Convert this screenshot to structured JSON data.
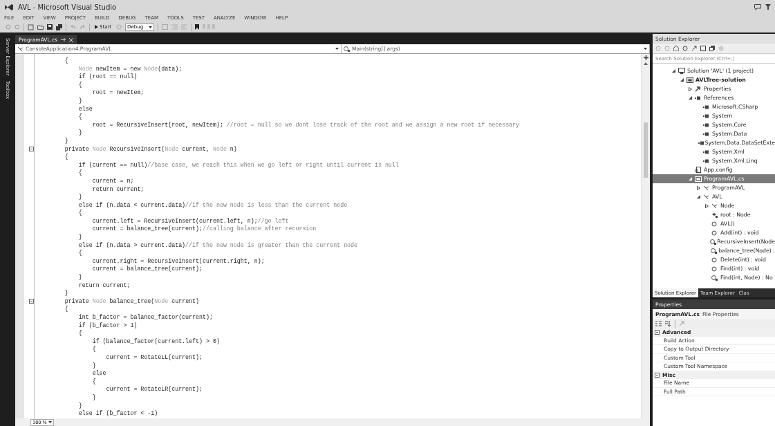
{
  "window": {
    "title": "AVL - Microsoft Visual Studio"
  },
  "menu": [
    "FILE",
    "EDIT",
    "VIEW",
    "PROJECT",
    "BUILD",
    "DEBUG",
    "TEAM",
    "TOOLS",
    "TEST",
    "ANALYZE",
    "WINDOW",
    "HELP"
  ],
  "toolbar": {
    "start": "Start",
    "configuration": "Debug"
  },
  "side_tabs": [
    "Server Explorer",
    "Toolbox"
  ],
  "editor": {
    "tabs": [
      {
        "label": "ProgramAVL.cs",
        "selected": true
      }
    ],
    "type_nav": "ConsoleApplication4.ProgramAVL",
    "member_nav": "Main(string[] args)",
    "zoom": "100 %",
    "lines": [
      {
        "fold": false,
        "tokens": [
          {
            "kind": "plain",
            "text": "        {"
          }
        ]
      },
      {
        "fold": false,
        "tokens": [
          {
            "kind": "type",
            "text": "            Node"
          },
          {
            "kind": "plain",
            "text": " newItem = new "
          },
          {
            "kind": "type",
            "text": "Node"
          },
          {
            "kind": "plain",
            "text": "(data);"
          }
        ]
      },
      {
        "fold": false,
        "tokens": [
          {
            "kind": "plain",
            "text": "            if (root == null)"
          }
        ]
      },
      {
        "fold": false,
        "tokens": [
          {
            "kind": "plain",
            "text": "            {"
          }
        ]
      },
      {
        "fold": false,
        "tokens": [
          {
            "kind": "plain",
            "text": "                root = newItem;"
          }
        ]
      },
      {
        "fold": false,
        "tokens": [
          {
            "kind": "plain",
            "text": "            }"
          }
        ]
      },
      {
        "fold": false,
        "tokens": [
          {
            "kind": "plain",
            "text": "            else"
          }
        ]
      },
      {
        "fold": false,
        "tokens": [
          {
            "kind": "plain",
            "text": "            {"
          }
        ]
      },
      {
        "fold": false,
        "tokens": [
          {
            "kind": "plain",
            "text": "                root = RecursiveInsert(root, newItem); "
          },
          {
            "kind": "comment",
            "text": "//root = null so we dont lose track of the root and we assign a new root if necessary"
          }
        ]
      },
      {
        "fold": false,
        "tokens": [
          {
            "kind": "plain",
            "text": "            }"
          }
        ]
      },
      {
        "fold": false,
        "tokens": [
          {
            "kind": "plain",
            "text": "        }"
          }
        ]
      },
      {
        "fold": true,
        "tokens": [
          {
            "kind": "plain",
            "text": "        private "
          },
          {
            "kind": "type",
            "text": "Node"
          },
          {
            "kind": "plain",
            "text": " RecursiveInsert("
          },
          {
            "kind": "type",
            "text": "Node"
          },
          {
            "kind": "plain",
            "text": " current, "
          },
          {
            "kind": "type",
            "text": "Node"
          },
          {
            "kind": "plain",
            "text": " n)"
          }
        ]
      },
      {
        "fold": false,
        "tokens": [
          {
            "kind": "plain",
            "text": "        {"
          }
        ]
      },
      {
        "fold": false,
        "tokens": [
          {
            "kind": "plain",
            "text": "            if (current == null)"
          },
          {
            "kind": "comment",
            "text": "//base case, we reach this when we go left or right until current is null"
          }
        ]
      },
      {
        "fold": false,
        "tokens": [
          {
            "kind": "plain",
            "text": "            {"
          }
        ]
      },
      {
        "fold": false,
        "tokens": [
          {
            "kind": "plain",
            "text": "                current = n;"
          }
        ]
      },
      {
        "fold": false,
        "tokens": [
          {
            "kind": "plain",
            "text": "                return current;"
          }
        ]
      },
      {
        "fold": false,
        "tokens": [
          {
            "kind": "plain",
            "text": "            }"
          }
        ]
      },
      {
        "fold": false,
        "tokens": [
          {
            "kind": "plain",
            "text": "            else if (n.data < current.data)"
          },
          {
            "kind": "comment",
            "text": "//if the new node is less than the current node"
          }
        ]
      },
      {
        "fold": false,
        "tokens": [
          {
            "kind": "plain",
            "text": "            {"
          }
        ]
      },
      {
        "fold": false,
        "tokens": [
          {
            "kind": "plain",
            "text": "                current.left = RecursiveInsert(current.left, n);"
          },
          {
            "kind": "comment",
            "text": "//go left"
          }
        ]
      },
      {
        "fold": false,
        "tokens": [
          {
            "kind": "plain",
            "text": "                current = balance_tree(current);"
          },
          {
            "kind": "comment",
            "text": "//calling balance after recursion"
          }
        ]
      },
      {
        "fold": false,
        "tokens": [
          {
            "kind": "plain",
            "text": "            }"
          }
        ]
      },
      {
        "fold": false,
        "tokens": [
          {
            "kind": "plain",
            "text": "            else if (n.data > current.data)"
          },
          {
            "kind": "comment",
            "text": "//if the new node is greater than the current node"
          }
        ]
      },
      {
        "fold": false,
        "tokens": [
          {
            "kind": "plain",
            "text": "            {"
          }
        ]
      },
      {
        "fold": false,
        "tokens": [
          {
            "kind": "plain",
            "text": "                current.right = RecursiveInsert(current.right, n);"
          }
        ]
      },
      {
        "fold": false,
        "tokens": [
          {
            "kind": "plain",
            "text": "                current = balance_tree(current);"
          }
        ]
      },
      {
        "fold": false,
        "tokens": [
          {
            "kind": "plain",
            "text": "            }"
          }
        ]
      },
      {
        "fold": false,
        "tokens": [
          {
            "kind": "plain",
            "text": "            return current;"
          }
        ]
      },
      {
        "fold": false,
        "tokens": [
          {
            "kind": "plain",
            "text": "        }"
          }
        ]
      },
      {
        "fold": true,
        "tokens": [
          {
            "kind": "plain",
            "text": "        private "
          },
          {
            "kind": "type",
            "text": "Node"
          },
          {
            "kind": "plain",
            "text": " balance_tree("
          },
          {
            "kind": "type",
            "text": "Node"
          },
          {
            "kind": "plain",
            "text": " current)"
          }
        ]
      },
      {
        "fold": false,
        "tokens": [
          {
            "kind": "plain",
            "text": "        {"
          }
        ]
      },
      {
        "fold": false,
        "tokens": [
          {
            "kind": "plain",
            "text": "            int b_factor = balance_factor(current);"
          }
        ]
      },
      {
        "fold": false,
        "tokens": [
          {
            "kind": "plain",
            "text": "            if (b_factor > 1)"
          }
        ]
      },
      {
        "fold": false,
        "tokens": [
          {
            "kind": "plain",
            "text": "            {"
          }
        ]
      },
      {
        "fold": false,
        "tokens": [
          {
            "kind": "plain",
            "text": "                if (balance_factor(current.left) > 0)"
          }
        ]
      },
      {
        "fold": false,
        "tokens": [
          {
            "kind": "plain",
            "text": "                {"
          }
        ]
      },
      {
        "fold": false,
        "tokens": [
          {
            "kind": "plain",
            "text": "                    current = RotateLL(current);"
          }
        ]
      },
      {
        "fold": false,
        "tokens": [
          {
            "kind": "plain",
            "text": "                }"
          }
        ]
      },
      {
        "fold": false,
        "tokens": [
          {
            "kind": "plain",
            "text": "                else"
          }
        ]
      },
      {
        "fold": false,
        "tokens": [
          {
            "kind": "plain",
            "text": "                {"
          }
        ]
      },
      {
        "fold": false,
        "tokens": [
          {
            "kind": "plain",
            "text": "                    current = RotateLR(current);"
          }
        ]
      },
      {
        "fold": false,
        "tokens": [
          {
            "kind": "plain",
            "text": "                }"
          }
        ]
      },
      {
        "fold": false,
        "tokens": [
          {
            "kind": "plain",
            "text": "            }"
          }
        ]
      },
      {
        "fold": false,
        "tokens": [
          {
            "kind": "plain",
            "text": "            else if (b_factor < -1)"
          }
        ]
      }
    ]
  },
  "solution_explorer": {
    "title": "Solution Explorer",
    "search": {
      "placeholder": "Search Solution Explorer (Ctrl+;)"
    },
    "tree": [
      {
        "label": "Solution 'AVL' (1 project)",
        "kind": "solution",
        "selected": false,
        "expanded": true,
        "children": [
          {
            "label": "AVLTree-solution",
            "kind": "project",
            "selected": false,
            "expanded": true,
            "children": [
              {
                "label": "Properties",
                "kind": "properties",
                "selected": false,
                "expanded": false
              },
              {
                "label": "References",
                "kind": "references",
                "selected": false,
                "expanded": true,
                "children": [
                  {
                    "label": "Microsoft.CSharp",
                    "kind": "reference",
                    "selected": false
                  },
                  {
                    "label": "System",
                    "kind": "reference",
                    "selected": false
                  },
                  {
                    "label": "System.Core",
                    "kind": "reference",
                    "selected": false
                  },
                  {
                    "label": "System.Data",
                    "kind": "reference",
                    "selected": false
                  },
                  {
                    "label": "System.Data.DataSetExte",
                    "kind": "reference",
                    "selected": false
                  },
                  {
                    "label": "System.Xml",
                    "kind": "reference",
                    "selected": false
                  },
                  {
                    "label": "System.Xml.Linq",
                    "kind": "reference",
                    "selected": false
                  }
                ]
              },
              {
                "label": "App.config",
                "kind": "config",
                "selected": false
              },
              {
                "label": "ProgramAVL.cs",
                "kind": "file",
                "selected": true,
                "expanded": true,
                "children": [
                  {
                    "label": "ProgramAVL",
                    "kind": "class",
                    "selected": false,
                    "expanded": false
                  },
                  {
                    "label": "AVL",
                    "kind": "class",
                    "selected": false,
                    "expanded": true,
                    "children": [
                      {
                        "label": "Node",
                        "kind": "class",
                        "selected": false,
                        "expanded": false
                      },
                      {
                        "label": "root : Node",
                        "kind": "field",
                        "selected": false
                      },
                      {
                        "label": "AVL()",
                        "kind": "method",
                        "selected": false
                      },
                      {
                        "label": "Add(int) : void",
                        "kind": "method",
                        "selected": false
                      },
                      {
                        "label": "RecursiveInsert(Node",
                        "kind": "private_method",
                        "selected": false
                      },
                      {
                        "label": "balance_tree(Node) :",
                        "kind": "private_method",
                        "selected": false
                      },
                      {
                        "label": "Delete(int) : void",
                        "kind": "method",
                        "selected": false
                      },
                      {
                        "label": "Find(int) : void",
                        "kind": "method",
                        "selected": false
                      },
                      {
                        "label": "Find(int, Node) : No",
                        "kind": "private_method",
                        "selected": false
                      }
                    ]
                  }
                ]
              }
            ]
          }
        ]
      }
    ],
    "tabs": [
      {
        "label": "Solution Explorer",
        "selected": true
      },
      {
        "label": "Team Explorer",
        "selected": false
      },
      {
        "label": "Clas",
        "selected": false
      }
    ]
  },
  "properties": {
    "title": "Properties",
    "object_name": "ProgramAVL.cs",
    "object_type": "File Properties",
    "categories": [
      {
        "name": "Advanced",
        "expanded": true,
        "rows": [
          "Build Action",
          "Copy to Output Directory",
          "Custom Tool",
          "Custom Tool Namespace"
        ]
      },
      {
        "name": "Misc",
        "expanded": true,
        "rows": [
          "File Name",
          "Full Path"
        ]
      }
    ]
  }
}
